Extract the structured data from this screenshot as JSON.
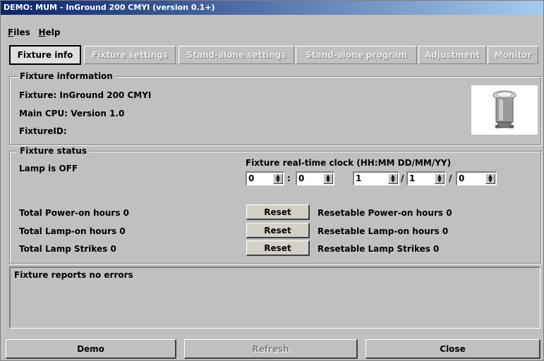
{
  "window": {
    "title": "DEMO: MUM - InGround 200 CMYI (version 0.1+)"
  },
  "menu": [
    {
      "label": "Files",
      "mnemonic": "F",
      "rest": "iles"
    },
    {
      "label": "Help",
      "mnemonic": "H",
      "rest": "elp"
    }
  ],
  "tabs": [
    {
      "label": "Fixture info",
      "active": true
    },
    {
      "label": "Fixture settings",
      "active": false
    },
    {
      "label": "Stand-alone settings",
      "active": false
    },
    {
      "label": "Stand-alone program",
      "active": false
    },
    {
      "label": "Adjustment",
      "active": false
    },
    {
      "label": "Monitor",
      "active": false
    }
  ],
  "fixture_information": {
    "title": "Fixture information",
    "fixture": "Fixture: InGround 200 CMYI",
    "cpu": "Main CPU: Version 1.0",
    "fixture_id": "FixtureID:"
  },
  "fixture_status": {
    "title": "Fixture status",
    "lamp": "Lamp is OFF",
    "clock_label": "Fixture real-time clock (HH:MM  DD/MM/YY)",
    "clock": {
      "hh": "0",
      "mm": "0",
      "dd": "1",
      "month": "1",
      "yy": "0",
      "sep_time": ":",
      "sep_date": "/"
    },
    "rows": [
      {
        "total": "Total Power-on hours 0",
        "reset": "Reset",
        "resetable": "Resetable Power-on hours 0"
      },
      {
        "total": "Total Lamp-on hours 0",
        "reset": "Reset",
        "resetable": "Resetable Lamp-on hours 0"
      },
      {
        "total": "Total Lamp Strikes 0",
        "reset": "Reset",
        "resetable": "Resetable Lamp Strikes 0"
      }
    ]
  },
  "messages": {
    "text": "Fixture reports no errors"
  },
  "footer": {
    "demo": "Demo",
    "refresh": "Refresh",
    "close": "Close"
  },
  "colors": {
    "titlebar_start": "#0a246a",
    "titlebar_end": "#a6caf0",
    "face": "#c0c0c0"
  }
}
